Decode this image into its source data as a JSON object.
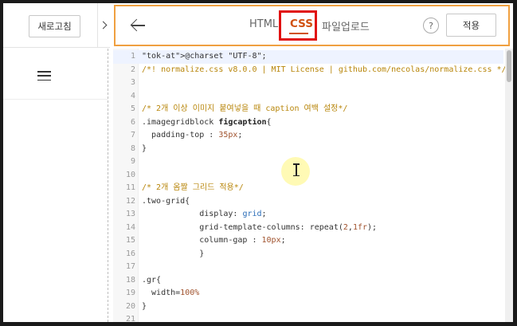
{
  "left_panel": {
    "refresh_label": "새로고침"
  },
  "header": {
    "tabs": [
      {
        "label": "HTML"
      },
      {
        "label": "CSS"
      },
      {
        "label": "파일업로드"
      }
    ],
    "help_label": "?",
    "apply_label": "적용",
    "highlight_color": "#f0a040",
    "active_tab_color": "#d05010"
  },
  "editor": {
    "lines": [
      {
        "n": "1",
        "text": "@charset \"UTF-8\";"
      },
      {
        "n": "2",
        "text": "/*! normalize.css v8.0.0 | MIT License | github.com/necolas/normalize.css */"
      },
      {
        "n": "3",
        "text": ""
      },
      {
        "n": "4",
        "text": ""
      },
      {
        "n": "5",
        "text": "/* 2개 이상 이미지 붙여넣을 때 caption 여백 설정*/"
      },
      {
        "n": "6",
        "text": ".imagegridblock figcaption{"
      },
      {
        "n": "7",
        "text": "  padding-top : 35px;"
      },
      {
        "n": "8",
        "text": "}"
      },
      {
        "n": "9",
        "text": ""
      },
      {
        "n": "10",
        "text": ""
      },
      {
        "n": "11",
        "text": "/* 2개 옴짤 그리드 적용*/"
      },
      {
        "n": "12",
        "text": ".two-grid{"
      },
      {
        "n": "13",
        "text": "            display: grid;"
      },
      {
        "n": "14",
        "text": "            grid-template-columns: repeat(2,1fr);"
      },
      {
        "n": "15",
        "text": "            column-gap : 10px;"
      },
      {
        "n": "16",
        "text": "            }"
      },
      {
        "n": "17",
        "text": ""
      },
      {
        "n": "18",
        "text": ".gr{"
      },
      {
        "n": "19",
        "text": "  width=100%"
      },
      {
        "n": "20",
        "text": "}"
      },
      {
        "n": "21",
        "text": ""
      }
    ]
  }
}
